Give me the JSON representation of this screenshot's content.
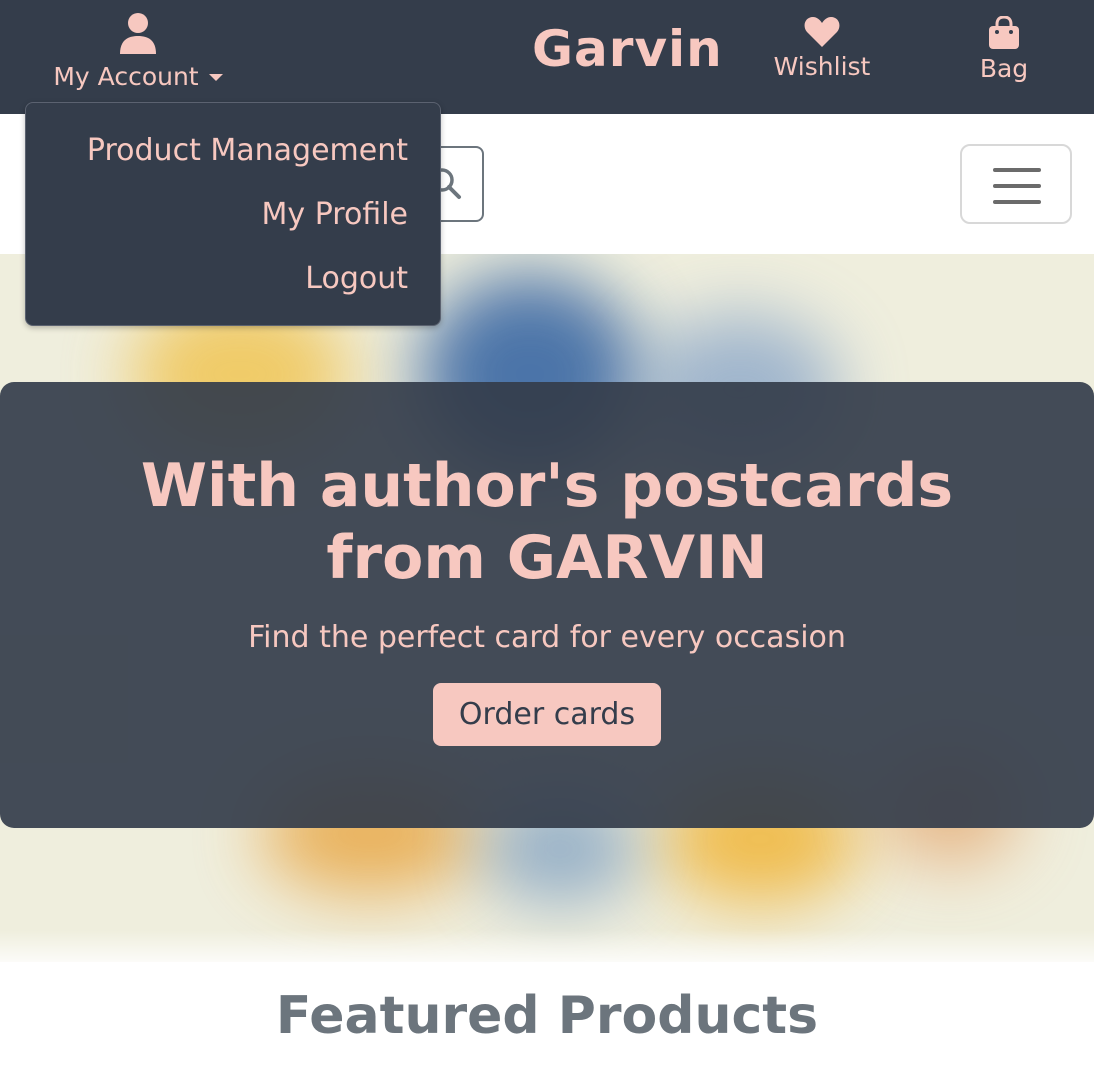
{
  "navbar": {
    "account_label": "My Account",
    "brand": "Garvin",
    "wishlist_label": "Wishlist",
    "bag_label": "Bag",
    "icons": {
      "account": "user-icon",
      "account_caret": "caret-down-icon",
      "wishlist": "heart-icon",
      "bag": "shopping-bag-icon"
    }
  },
  "account_menu": {
    "items": [
      {
        "label": "Product Management"
      },
      {
        "label": "My Profile"
      },
      {
        "label": "Logout"
      }
    ]
  },
  "search": {
    "placeholder": "",
    "icon": "search-icon"
  },
  "menu_toggle": {
    "icon": "hamburger-menu-icon"
  },
  "hero": {
    "title": "With author's postcards from GARVIN",
    "subtitle": "Find the perfect card for every occasion",
    "cta_label": "Order cards"
  },
  "featured": {
    "heading": "Featured Products"
  },
  "colors": {
    "nav_bg": "#343d4b",
    "accent_pink": "#f7c8c0",
    "muted_gray": "#6c757d"
  }
}
